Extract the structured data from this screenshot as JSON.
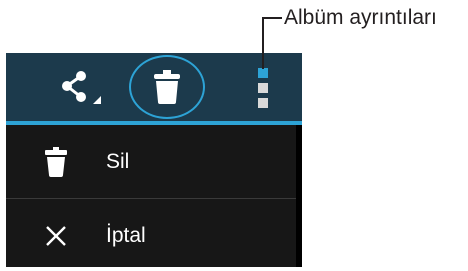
{
  "callout": {
    "label": "Albüm ayrıntıları"
  },
  "action_bar": {
    "share_icon": "share-icon",
    "delete_icon": "trash-icon",
    "overflow_icon": "overflow-menu-icon"
  },
  "menu": {
    "items": [
      {
        "label": "Sil",
        "icon": "trash-icon"
      },
      {
        "label": "İptal",
        "icon": "close-icon"
      }
    ]
  },
  "colors": {
    "action_bar_background": "#1c3a4c",
    "accent": "#2da3d6",
    "menu_background": "#171717",
    "callout_text": "#231f20"
  }
}
